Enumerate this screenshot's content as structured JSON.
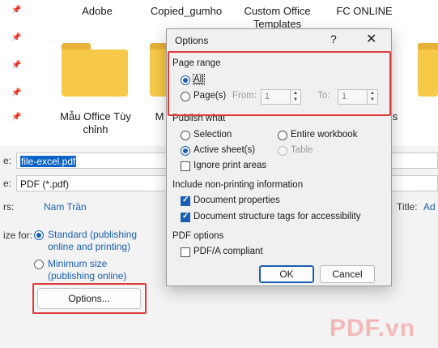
{
  "background": {
    "file_names": [
      "Adobe",
      "Copied_gumho",
      "Custom Office Templates",
      "FC ONLINE"
    ],
    "folder_label": "Mẫu Office Tùy chỉnh",
    "folder_partial_left": "M",
    "folder_partial_right": "s",
    "file_name_label": "e:",
    "file_name_value": "file-excel.pdf",
    "save_type_label": "e:",
    "save_type_value": "PDF (*.pdf)",
    "authors_label": "rs:",
    "authors_value": "Nam Trần",
    "title_label": "Title:",
    "title_value": "Ad",
    "optimize_label": "ize for:",
    "optimize_standard": "Standard (publishing online and printing)",
    "optimize_minimum": "Minimum size (publishing online)",
    "options_button": "Options..."
  },
  "dialog": {
    "title": "Options",
    "help_icon": "?",
    "close_icon": "✕",
    "page_range": {
      "heading": "Page range",
      "all_label": "All",
      "pages_label": "Page(s)",
      "from_label": "From:",
      "from_value": "1",
      "to_label": "To:",
      "to_value": "1"
    },
    "publish_what": {
      "heading": "Publish what",
      "selection": "Selection",
      "entire_workbook": "Entire workbook",
      "active_sheets": "Active sheet(s)",
      "table": "Table",
      "ignore_print_areas": "Ignore print areas"
    },
    "non_printing": {
      "heading": "Include non-printing information",
      "document_properties": "Document properties",
      "structure_tags": "Document structure tags for accessibility"
    },
    "pdf_options": {
      "heading": "PDF options",
      "pdfa": "PDF/A compliant"
    },
    "ok": "OK",
    "cancel": "Cancel"
  },
  "watermark": "PDF.vn",
  "colors": {
    "accent": "#1a5fb4",
    "highlight": "#e03b3b",
    "folder": "#f7c948"
  }
}
